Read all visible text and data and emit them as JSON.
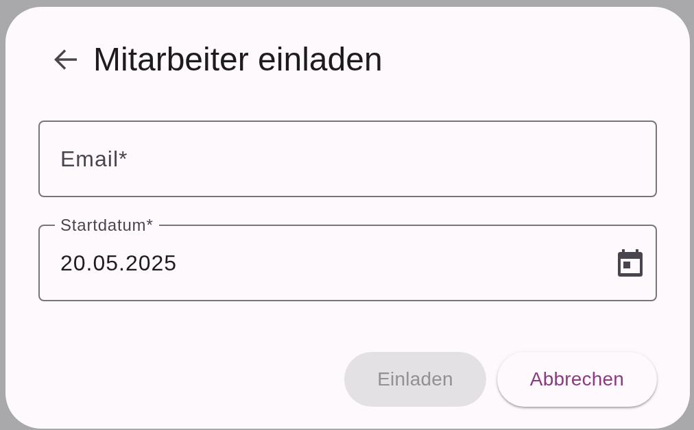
{
  "dialog": {
    "title": "Mitarbeiter einladen"
  },
  "fields": [
    {
      "kind": "text",
      "label": "Email*"
    },
    {
      "kind": "date",
      "label": "Startdatum*",
      "value": "20.05.2025"
    }
  ],
  "buttons": [
    {
      "kind": "filled",
      "label": "Einladen",
      "disabled": true
    },
    {
      "kind": "elevated",
      "label": "Abbrechen",
      "disabled": false
    }
  ]
}
